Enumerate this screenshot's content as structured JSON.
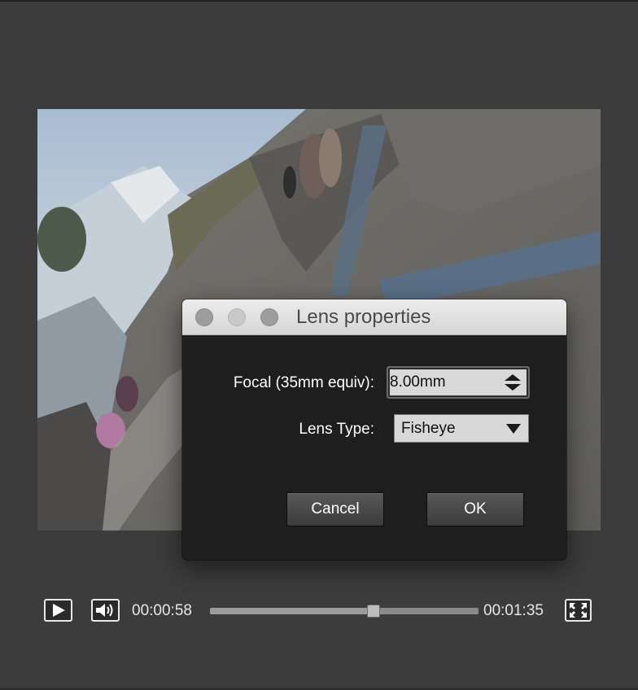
{
  "dialog": {
    "title": "Lens properties",
    "focal_label": "Focal (35mm equiv):",
    "focal_value": "8.00mm",
    "lens_type_label": "Lens Type:",
    "lens_type_value": "Fisheye",
    "cancel_label": "Cancel",
    "ok_label": "OK"
  },
  "player": {
    "current_time": "00:00:58",
    "total_time": "00:01:35",
    "progress": 0.61,
    "icons": {
      "play": "play-icon",
      "volume": "volume-icon",
      "fullscreen": "fullscreen-icon"
    }
  },
  "colors": {
    "background": "#3c3c3c",
    "dialog_bg": "#1e1e1e",
    "titlebar": "#e0e0e0"
  }
}
